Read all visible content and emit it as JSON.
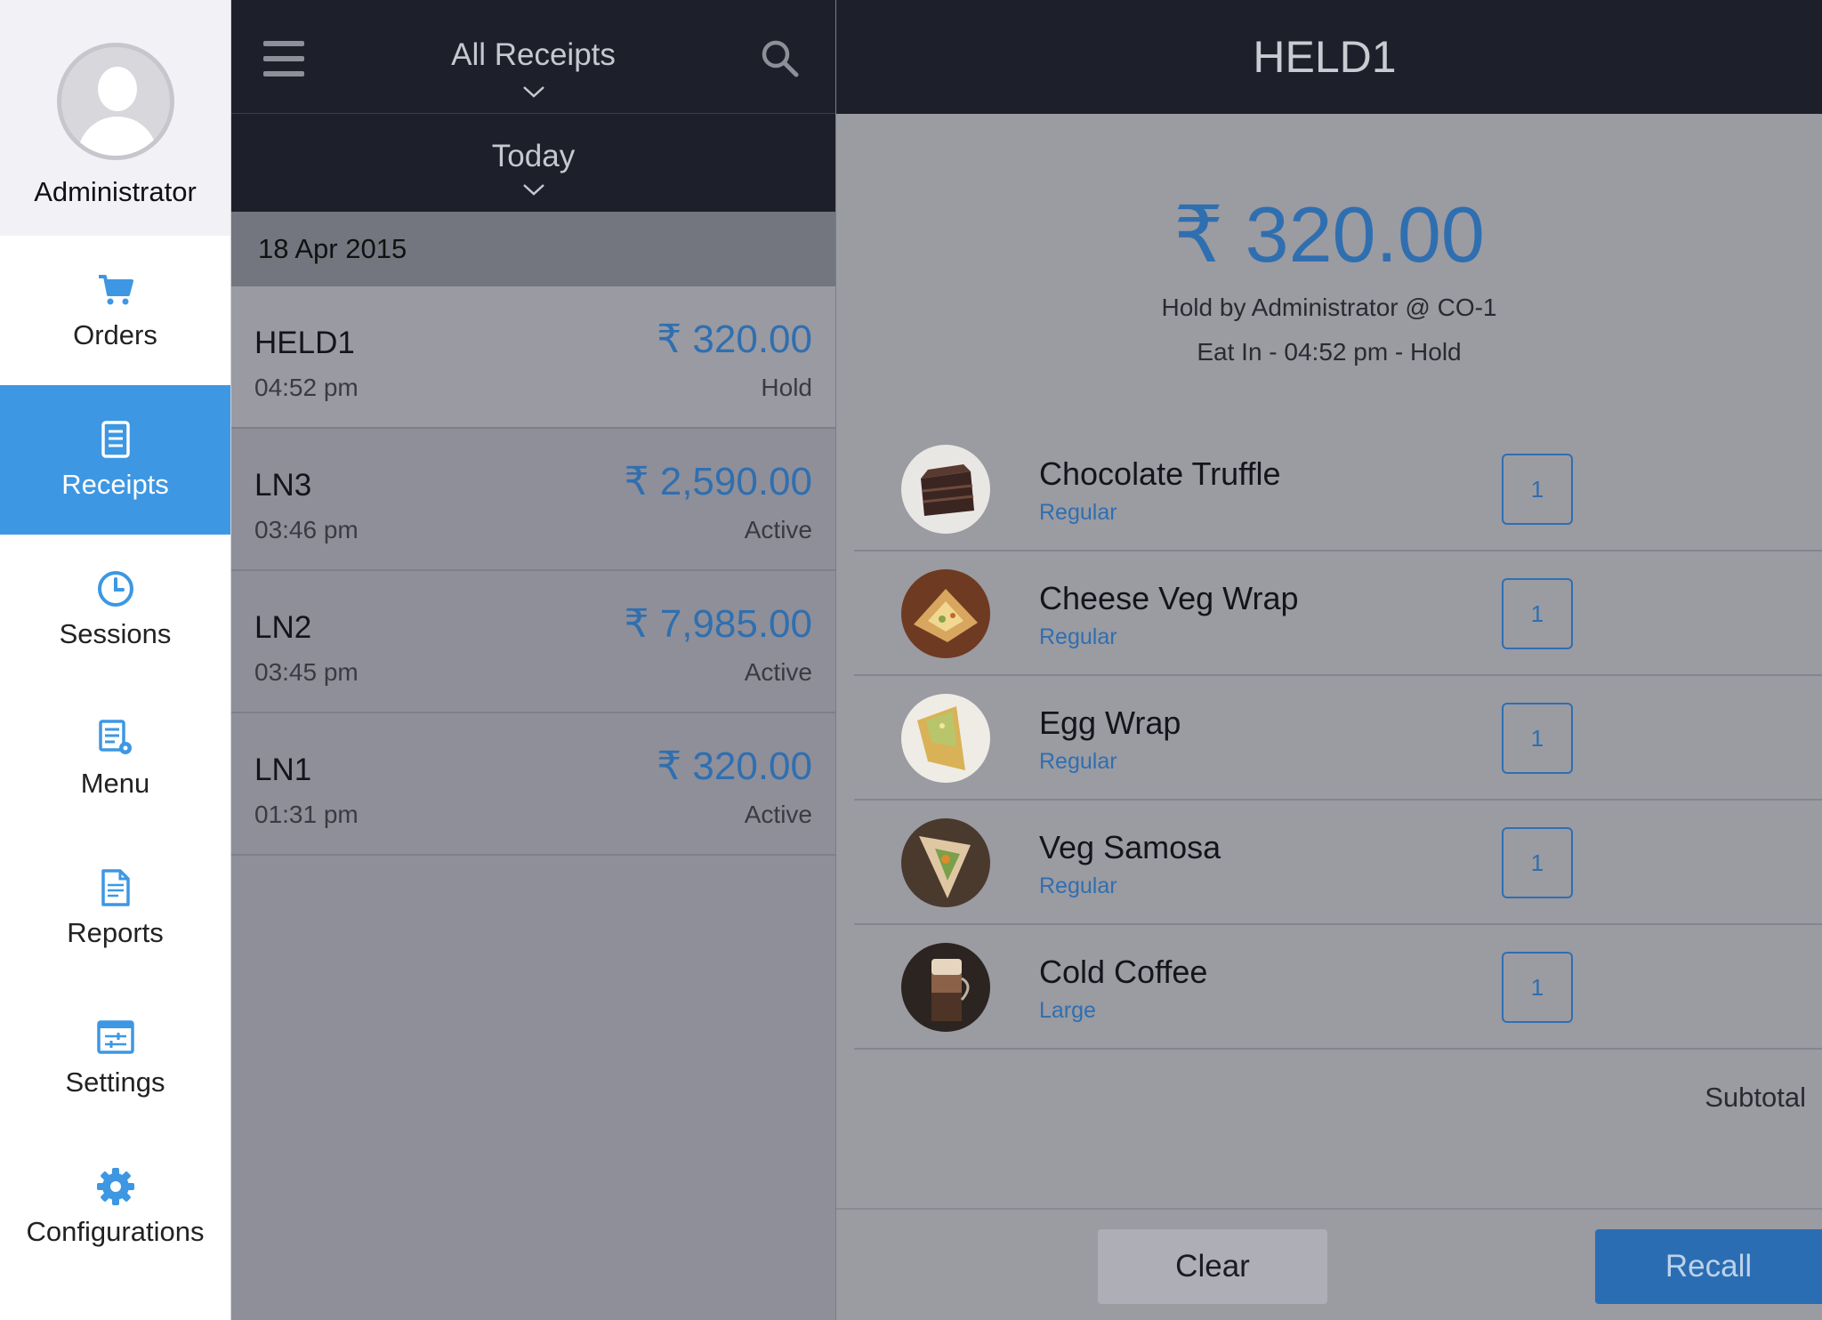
{
  "colors": {
    "accent": "#3d97e3",
    "amount": "#2f6fb0",
    "header_bg": "#1d202a",
    "active_nav": "#3d97e3"
  },
  "profile": {
    "name": "Administrator",
    "avatar_icon": "user-silhouette-icon"
  },
  "nav": {
    "items": [
      {
        "label": "Orders",
        "icon": "cart-icon",
        "active": false
      },
      {
        "label": "Receipts",
        "icon": "receipt-icon",
        "active": true
      },
      {
        "label": "Sessions",
        "icon": "clock-icon",
        "active": false
      },
      {
        "label": "Menu",
        "icon": "menu-settings-icon",
        "active": false
      },
      {
        "label": "Reports",
        "icon": "document-icon",
        "active": false
      },
      {
        "label": "Settings",
        "icon": "sliders-icon",
        "active": false
      },
      {
        "label": "Configurations",
        "icon": "gear-icon",
        "active": false
      }
    ]
  },
  "list": {
    "filter_title": "All Receipts",
    "date_filter": "Today",
    "section_date": "18 Apr 2015",
    "receipts": [
      {
        "name": "HELD1",
        "time": "04:52 pm",
        "amount": "₹ 320.00",
        "status": "Hold",
        "selected": true
      },
      {
        "name": "LN3",
        "time": "03:46 pm",
        "amount": "₹ 2,590.00",
        "status": "Active",
        "selected": false
      },
      {
        "name": "LN2",
        "time": "03:45 pm",
        "amount": "₹ 7,985.00",
        "status": "Active",
        "selected": false
      },
      {
        "name": "LN1",
        "time": "01:31 pm",
        "amount": "₹ 320.00",
        "status": "Active",
        "selected": false
      }
    ]
  },
  "detail": {
    "title": "HELD1",
    "total": "₹ 320.00",
    "hold_info": "Hold by Administrator @ CO-1",
    "order_info": "Eat In - 04:52 pm - Hold",
    "items": [
      {
        "name": "Chocolate Truffle",
        "variant": "Regular",
        "qty": "1"
      },
      {
        "name": "Cheese Veg Wrap",
        "variant": "Regular",
        "qty": "1"
      },
      {
        "name": "Egg Wrap",
        "variant": "Regular",
        "qty": "1"
      },
      {
        "name": "Veg Samosa",
        "variant": "Regular",
        "qty": "1"
      },
      {
        "name": "Cold Coffee",
        "variant": "Large",
        "qty": "1"
      }
    ],
    "subtotal_label": "Subtotal",
    "clear_label": "Clear",
    "recall_label": "Recall"
  }
}
